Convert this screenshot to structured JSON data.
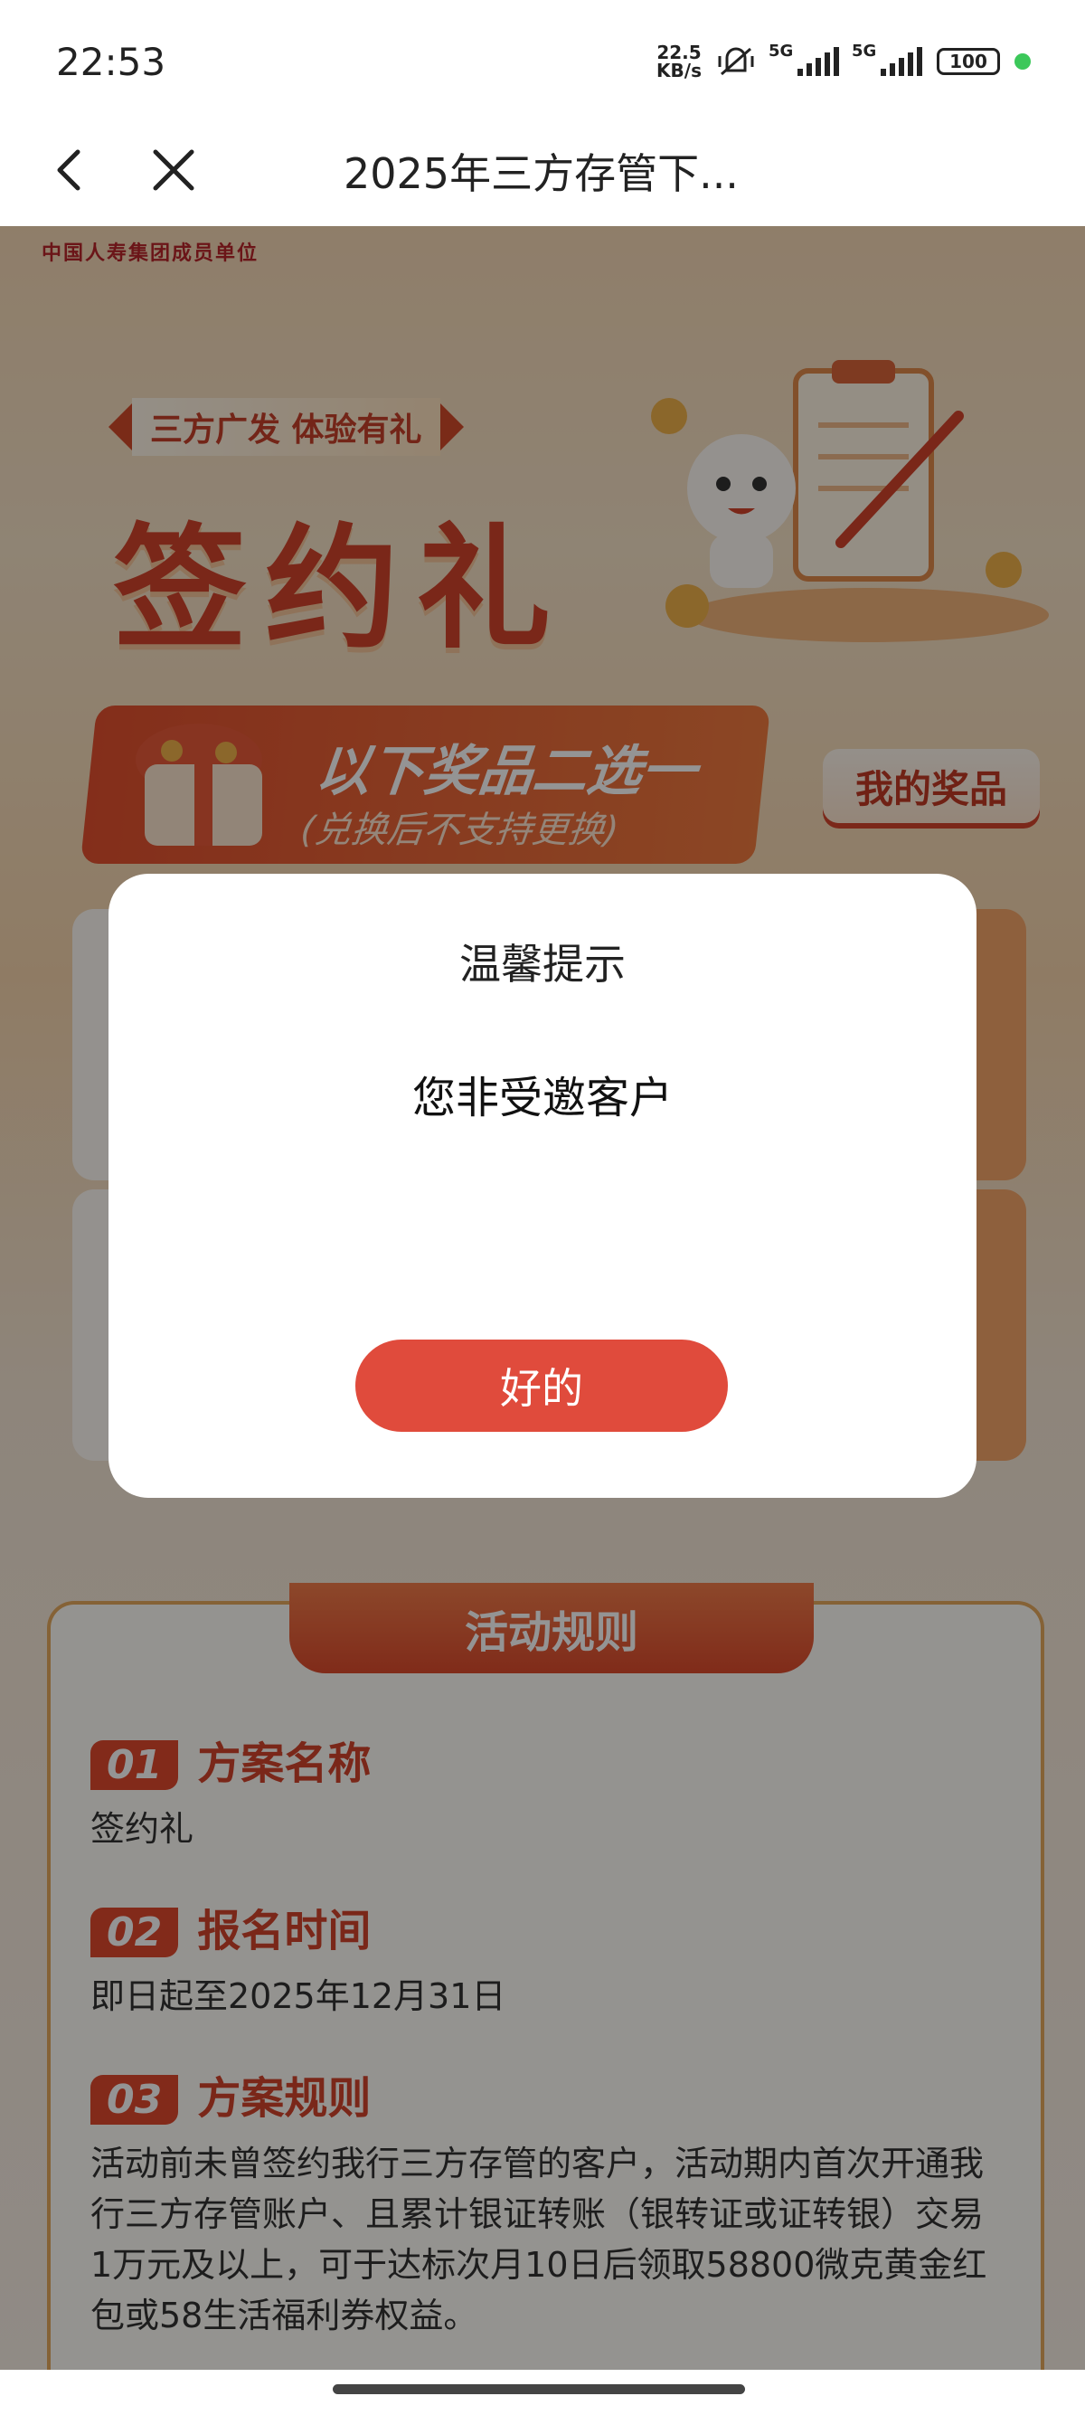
{
  "status_bar": {
    "time": "22:53",
    "net_speed_value": "22.5",
    "net_speed_unit": "KB/s",
    "sim1": "5G",
    "sim2": "5G",
    "battery": "100"
  },
  "title_bar": {
    "title": "2025年三方存管下..."
  },
  "page": {
    "brand_subtitle": "中国人寿集团成员单位",
    "ribbon": "三方广发 体验有礼",
    "main_title": "签约礼",
    "prize_banner_title": "以下奖品二选一",
    "prize_banner_note": "(兑换后不支持更换)",
    "my_prizes_button": "我的奖品",
    "rules_header": "活动规则",
    "rules": [
      {
        "num": "01",
        "name": "方案名称",
        "value": "签约礼"
      },
      {
        "num": "02",
        "name": "报名时间",
        "value": "即日起至2025年12月31日"
      },
      {
        "num": "03",
        "name": "方案规则",
        "value": "活动前未曾签约我行三方存管的客户，活动期内首次开通我行三方存管账户、且累计银证转账（银转证或证转银）交易1万元及以上，可于达标次月10日后领取58800微克黄金红包或58生活福利券权益。"
      }
    ]
  },
  "dialog": {
    "title": "温馨提示",
    "message": "您非受邀客户",
    "ok_button": "好的"
  },
  "colors": {
    "accent": "#e04b3c",
    "brand_red": "#d2442c",
    "status_dot": "#3cc85a"
  }
}
